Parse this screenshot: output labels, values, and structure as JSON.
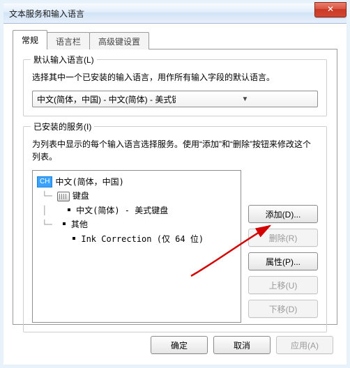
{
  "window": {
    "title": "文本服务和输入语言"
  },
  "tabs": {
    "general": "常规",
    "langbar": "语言栏",
    "advanced": "高级键设置"
  },
  "defaultLang": {
    "legend": "默认输入语言(L)",
    "desc": "选择其中一个已安装的输入语言，用作所有输入字段的默认语言。",
    "value": "中文(简体，中国) - 中文(简体) - 美式键盘"
  },
  "services": {
    "legend": "已安装的服务(I)",
    "desc": "为列表中显示的每个输入语言选择服务。使用“添加”和“删除”按钮来修改这个列表。",
    "tree": {
      "badge": "CH",
      "rootLabel": "中文(简体，中国)",
      "keyboardLabel": "键盘",
      "kb1": "中文(简体) - 美式键盘",
      "otherLabel": "其他",
      "other1": "Ink Correction (仅 64 位)"
    },
    "buttons": {
      "add": "添加(D)...",
      "remove": "删除(R)",
      "props": "属性(P)...",
      "up": "上移(U)",
      "down": "下移(D)"
    }
  },
  "footer": {
    "ok": "确定",
    "cancel": "取消",
    "apply": "应用(A)"
  }
}
